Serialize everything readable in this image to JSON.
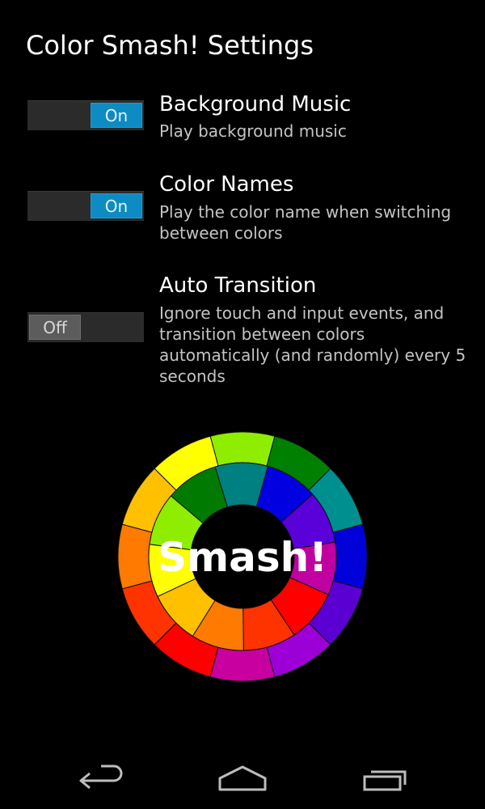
{
  "header": {
    "title": "Color Smash! Settings"
  },
  "settings": [
    {
      "title": "Background Music",
      "summary": "Play background music",
      "toggle": {
        "state": "on",
        "label": "On"
      }
    },
    {
      "title": "Color Names",
      "summary": "Play the color name when switching between colors",
      "toggle": {
        "state": "on",
        "label": "On"
      }
    },
    {
      "title": "Auto Transition",
      "summary": "Ignore touch and input events, and transition between colors automatically (and randomly) every 5 seconds",
      "toggle": {
        "state": "off",
        "label": "Off"
      }
    }
  ],
  "smash_wheel": {
    "label": "Smash!",
    "outer_ring_colors": [
      "#8fee00",
      "#008000",
      "#008f8f",
      "#0000d8",
      "#5b00d2",
      "#9c00d6",
      "#c800a0",
      "#ff0000",
      "#ff3300",
      "#ff7a00",
      "#ffc000",
      "#ffff00"
    ],
    "inner_ring_colors": [
      "#008080",
      "#0000e0",
      "#5a00d8",
      "#c000a0",
      "#ff0000",
      "#ff3300",
      "#ff7a00",
      "#ffc000",
      "#ffff00",
      "#8fee00",
      "#007a00"
    ]
  },
  "colors": {
    "accent": "#0e8bc2",
    "background": "#000000",
    "summary_text": "#c4c4c4"
  },
  "nav_bar": {
    "icons": [
      "back-icon",
      "home-icon",
      "recent-apps-icon"
    ]
  }
}
